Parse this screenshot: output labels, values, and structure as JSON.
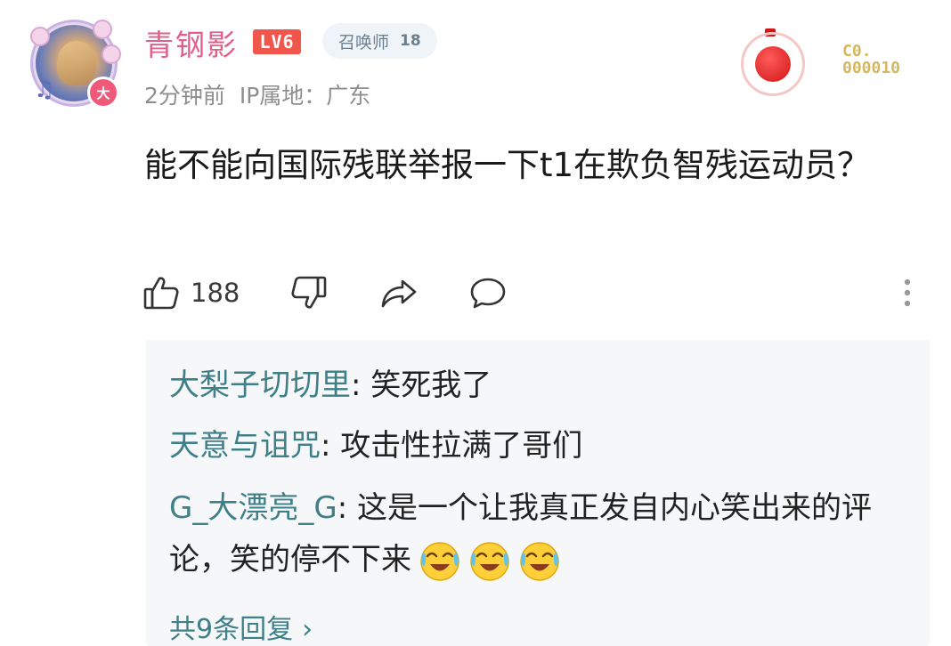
{
  "user": {
    "name": "青钢影",
    "level": "LV6",
    "title_tag": "召唤师",
    "title_tag_num": "18",
    "avatar_badge": "大",
    "meta_time": "2分钟前",
    "meta_ip": "IP属地：广东"
  },
  "decor": {
    "code_line1": "C0.",
    "code_line2": "000010"
  },
  "comment": {
    "text": "能不能向国际残联举报一下t1在欺负智残运动员？"
  },
  "actions": {
    "like_count": "188",
    "icons": [
      "thumbs-up-icon",
      "thumbs-down-icon",
      "share-icon",
      "comment-icon",
      "more-vertical-icon"
    ]
  },
  "replies": {
    "items": [
      {
        "name": "大梨子切切里",
        "sep": ": ",
        "text": "笑死我了"
      },
      {
        "name": "天意与诅咒",
        "sep": ": ",
        "text": "攻击性拉满了哥们"
      },
      {
        "name": "G_大漂亮_G",
        "sep": ": ",
        "text": "这是一个让我真正发自内心笑出来的评论，笑的停不下来"
      }
    ],
    "more_label": "共9条回复",
    "emoji": "laughing-crying-emoji"
  },
  "colors": {
    "username": "#e0608a",
    "reply_name": "#3f7f88",
    "level_badge": "#f0564c"
  }
}
